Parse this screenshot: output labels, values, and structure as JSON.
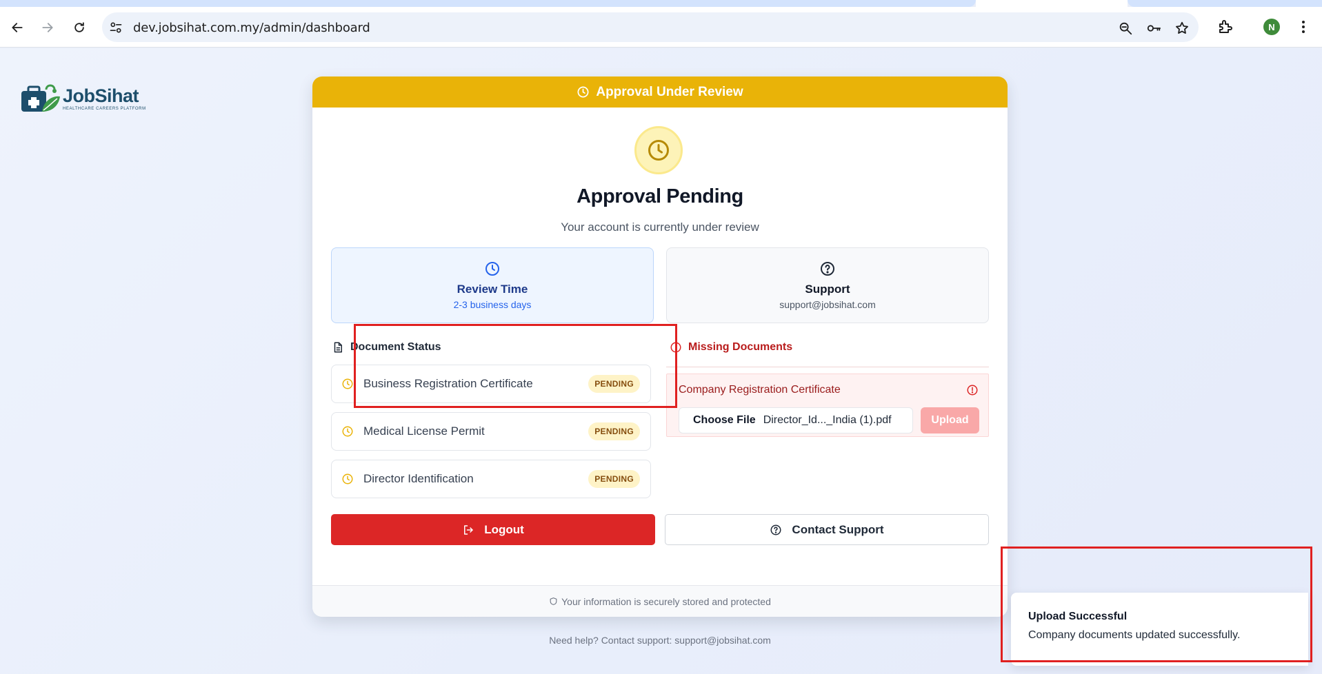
{
  "browser": {
    "url": "dev.jobsihat.com.my/admin/dashboard",
    "profile_initial": "N"
  },
  "brand": {
    "name": "JobSihat",
    "tagline": "HEALTHCARE CAREERS PLATFORM"
  },
  "card": {
    "banner": "Approval Under Review",
    "title": "Approval Pending",
    "subtitle": "Your account is currently under review",
    "review_box": {
      "title": "Review Time",
      "sub": "2-3 business days"
    },
    "support_box": {
      "title": "Support",
      "sub": "support@jobsihat.com"
    },
    "document_status_heading": "Document Status",
    "documents": [
      {
        "label": "Business Registration Certificate",
        "status": "PENDING"
      },
      {
        "label": "Medical License Permit",
        "status": "PENDING"
      },
      {
        "label": "Director Identification",
        "status": "PENDING"
      }
    ],
    "missing_heading": "Missing Documents",
    "missing": {
      "label": "Company Registration Certificate",
      "choose_file": "Choose File",
      "file_name": "Director_Id..._India (1).pdf",
      "upload": "Upload"
    },
    "logout": "Logout",
    "contact_support": "Contact Support",
    "footer": "Your information is securely stored and protected"
  },
  "help_text": "Need help? Contact support: support@jobsihat.com",
  "toast": {
    "title": "Upload Successful",
    "message": "Company documents updated successfully."
  },
  "colors": {
    "banner": "#e9b308",
    "danger": "#dc2626",
    "accent_blue": "#2563eb",
    "annotation_red": "#e02020"
  }
}
